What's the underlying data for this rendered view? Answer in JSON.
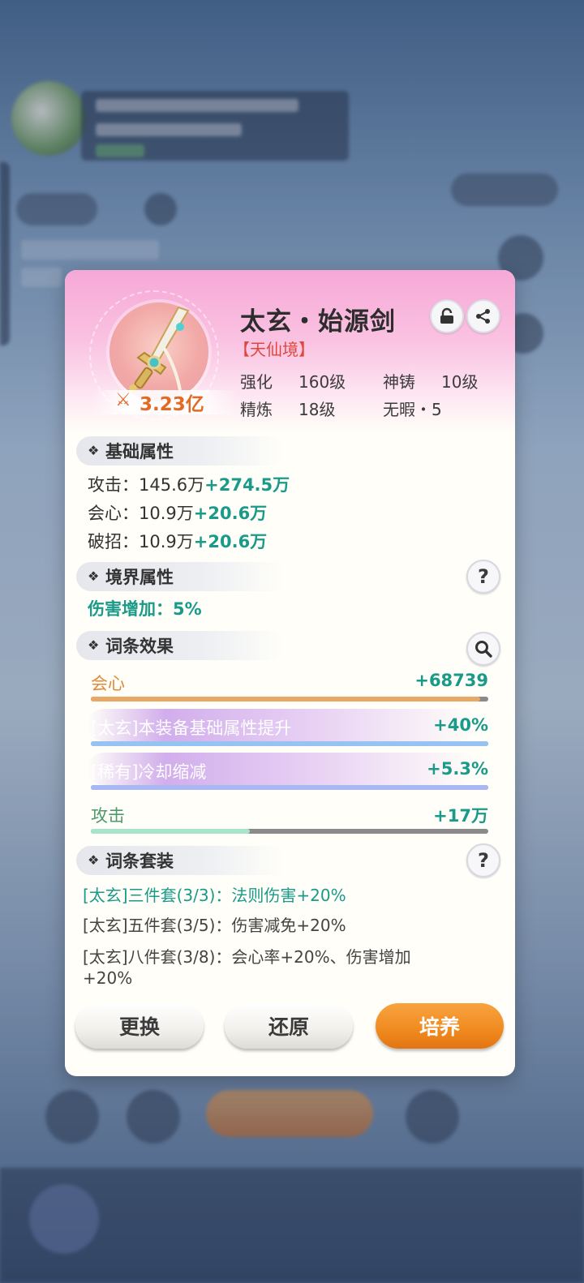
{
  "item": {
    "name": "太玄・始源剑",
    "tier": "【天仙境】",
    "power": "3.23亿",
    "stats": [
      {
        "label": "强化",
        "value": "160级"
      },
      {
        "label": "神铸",
        "value": "10级"
      },
      {
        "label": "精炼",
        "value": "18级"
      },
      {
        "label": "无暇・5",
        "value": ""
      }
    ]
  },
  "sections": {
    "base": "基础属性",
    "realm": "境界属性",
    "affix": "词条效果",
    "set": "词条套装"
  },
  "base_attrs": [
    {
      "label": "攻击：",
      "value": "145.6万",
      "bonus": "+274.5万"
    },
    {
      "label": "会心：",
      "value": "10.9万",
      "bonus": "+20.6万"
    },
    {
      "label": "破招：",
      "value": "10.9万",
      "bonus": "+20.6万"
    }
  ],
  "realm_attr": "伤害增加：5%",
  "affixes": [
    {
      "name": "会心",
      "value": "+68739",
      "fill": 0.98,
      "name_color": "#e08a3a",
      "value_color": "#1a9a88",
      "fill_color": "#eaa866"
    },
    {
      "name": "[太玄]本装备基础属性提升",
      "value": "+40%",
      "fill": 1.0,
      "name_color": "#ffffff",
      "value_color": "#1a9a88",
      "fill_color": "#97c3f2"
    },
    {
      "name": "[稀有]冷却缩减",
      "value": "+5.3%",
      "fill": 1.0,
      "name_color": "#ffffff",
      "value_color": "#1a9a88",
      "fill_color": "#a9b7f2"
    },
    {
      "name": "攻击",
      "value": "+17万",
      "fill": 0.4,
      "name_color": "#4f9a6c",
      "value_color": "#1a9a88",
      "fill_color": "#a9e3cc"
    }
  ],
  "sets": [
    {
      "text": "[太玄]三件套(3/3)：法则伤害+20%",
      "active": true
    },
    {
      "text": "[太玄]五件套(3/5)：伤害减免+20%",
      "active": false
    },
    {
      "text": "[太玄]八件套(3/8)：会心率+20%、伤害增加",
      "active": false
    },
    {
      "text": "+20%",
      "active": false
    }
  ],
  "buttons": {
    "replace": "更换",
    "restore": "还原",
    "cultivate": "培养"
  },
  "icons": {
    "lock": "lock-icon",
    "share": "share-icon",
    "help": "?",
    "search": "search-icon",
    "power": "crossed-swords-icon"
  },
  "colors": {
    "accent_teal": "#1a9a88",
    "orange": "#f08a1f",
    "tier_red": "#e0473a",
    "header_pink": "#f6a8d6"
  }
}
